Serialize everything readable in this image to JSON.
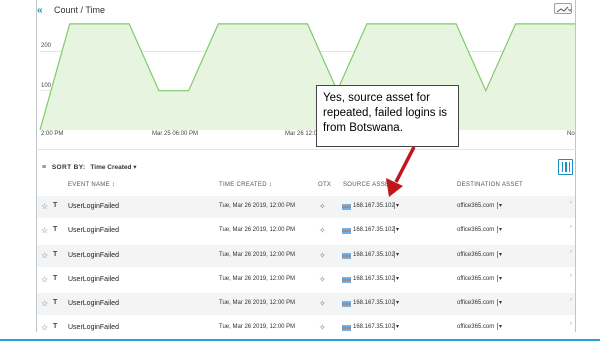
{
  "chart": {
    "title": "Count / Time",
    "collapse_icon": "double-chevron-left-icon",
    "type_button_icon": "line-chart-icon",
    "colors": {
      "line": "#7fcb6a",
      "fill": "#e7f4e0",
      "grid": "#d9dcdf"
    }
  },
  "chart_data": {
    "type": "area",
    "title": "Count / Time",
    "yticks": [
      100,
      200
    ],
    "ylim": [
      0,
      290
    ],
    "xticks": [
      "2:00 PM",
      "Mar 25 06:00 PM",
      "Mar 26 12:0",
      "No"
    ],
    "series": [
      {
        "values": [
          [
            0,
            0
          ],
          [
            1,
            270
          ],
          [
            2,
            270
          ],
          [
            3,
            270
          ],
          [
            4,
            100
          ],
          [
            5,
            100
          ],
          [
            6,
            270
          ],
          [
            7,
            270
          ],
          [
            8,
            270
          ],
          [
            9,
            270
          ],
          [
            10,
            100
          ],
          [
            11,
            270
          ],
          [
            12,
            270
          ],
          [
            13,
            270
          ],
          [
            14,
            270
          ],
          [
            15,
            100
          ],
          [
            16,
            270
          ],
          [
            17,
            270
          ],
          [
            18,
            270
          ]
        ]
      }
    ],
    "grid": true
  },
  "sort": {
    "icon": "sort-lines-icon",
    "label": "SORT BY:",
    "value": "Time Created",
    "chevron": "▾"
  },
  "columns_button_icon": "columns-icon",
  "table": {
    "headers": [
      "EVENT NAME ↕",
      "TIME CREATED ↕",
      "OTX",
      "SOURCE ASSET",
      "DESTINATION ASSET"
    ],
    "rows": [
      {
        "event": "UserLoginFailed",
        "time": "Tue, Mar 26 2019, 12:00 PM",
        "source": "168.167.35.102",
        "destination": "office365.com"
      },
      {
        "event": "UserLoginFailed",
        "time": "Tue, Mar 26 2019, 12:00 PM",
        "source": "168.167.35.102",
        "destination": "office365.com"
      },
      {
        "event": "UserLoginFailed",
        "time": "Tue, Mar 26 2019, 12:00 PM",
        "source": "168.167.35.102",
        "destination": "office365.com"
      },
      {
        "event": "UserLoginFailed",
        "time": "Tue, Mar 26 2019, 12:00 PM",
        "source": "168.167.35.102",
        "destination": "office365.com"
      },
      {
        "event": "UserLoginFailed",
        "time": "Tue, Mar 26 2019, 12:00 PM",
        "source": "168.167.35.102",
        "destination": "office365.com"
      },
      {
        "event": "UserLoginFailed",
        "time": "Tue, Mar 26 2019, 12:00 PM",
        "source": "168.167.35.102",
        "destination": "office365.com"
      }
    ],
    "glyphs": {
      "star": "☆",
      "filter": "T",
      "otx": "✧",
      "dropdown": "▾",
      "edge": "›"
    },
    "icons": {
      "star": "star-icon",
      "filter": "filter-icon",
      "otx": "otx-icon",
      "flag": "botswana-flag-icon"
    }
  },
  "callout": {
    "text": "Yes, source asset for repeated, failed logins is from Botswana.",
    "arrow_color": "#c0151b"
  }
}
